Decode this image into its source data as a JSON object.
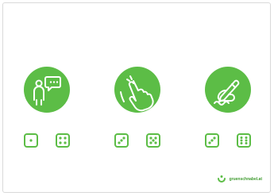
{
  "colors": {
    "accent": "#5cbd46",
    "border": "#d9d9d9"
  },
  "icons": [
    "person-speech-icon",
    "hand-tap-icon",
    "hand-write-icon"
  ],
  "dice": [
    [
      1,
      4
    ],
    [
      3,
      5
    ],
    [
      3,
      6
    ]
  ],
  "brand": {
    "text": "gruenschnabel.at"
  }
}
